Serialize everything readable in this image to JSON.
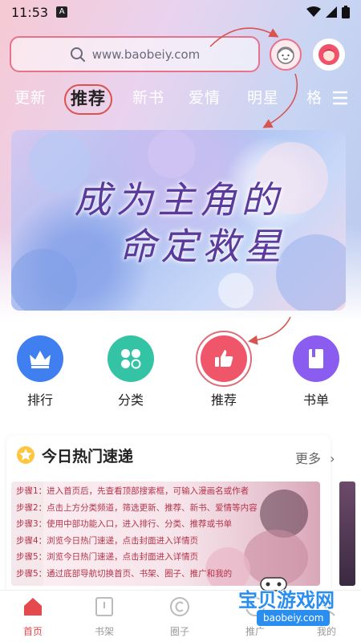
{
  "status_bar": {
    "time": "11:53",
    "notif_icon": "A"
  },
  "search": {
    "placeholder": "www.baobeiy.com"
  },
  "nav_tabs": [
    {
      "label": "更新"
    },
    {
      "label": "推荐"
    },
    {
      "label": "新书"
    },
    {
      "label": "爱情"
    },
    {
      "label": "明星"
    },
    {
      "label": "格"
    }
  ],
  "banner": {
    "title_line1": "成为主角的",
    "title_line2": "命定救星"
  },
  "quick_actions": [
    {
      "label": "排行",
      "icon": "crown-icon",
      "color": "#3f7ff0"
    },
    {
      "label": "分类",
      "icon": "grid-icon",
      "color": "#35c3a5"
    },
    {
      "label": "推荐",
      "icon": "thumbs-up-icon",
      "color": "#f0566a"
    },
    {
      "label": "书单",
      "icon": "book-icon",
      "color": "#8b5cf0"
    }
  ],
  "hot_section": {
    "title": "今日热门速递",
    "more_label": "更多",
    "steps": [
      "步骤1：进入首页后，先查看顶部搜索框，可输入漫画名或作者",
      "步骤2：点击上方分类频道，筛选更新、推荐、新书、爱情等内容",
      "步骤3：使用中部功能入口，进入排行、分类、推荐或书单",
      "步骤4：浏览今日热门速递，点击封面进入详情页",
      "步骤5：浏览今日热门速递，点击封面进入详情页",
      "步骤5：通过底部导航切换首页、书架、圈子、推广和我的"
    ]
  },
  "bottom_nav": [
    {
      "label": "首页",
      "active": true
    },
    {
      "label": "书架",
      "active": false
    },
    {
      "label": "圈子",
      "active": false
    },
    {
      "label": "推广",
      "active": false
    },
    {
      "label": "我的",
      "active": false
    }
  ],
  "watermark": {
    "title": "宝贝游戏网",
    "url": "baobeiy.com"
  },
  "colors": {
    "accent": "#e5484d",
    "annotation": "#d9534f"
  }
}
